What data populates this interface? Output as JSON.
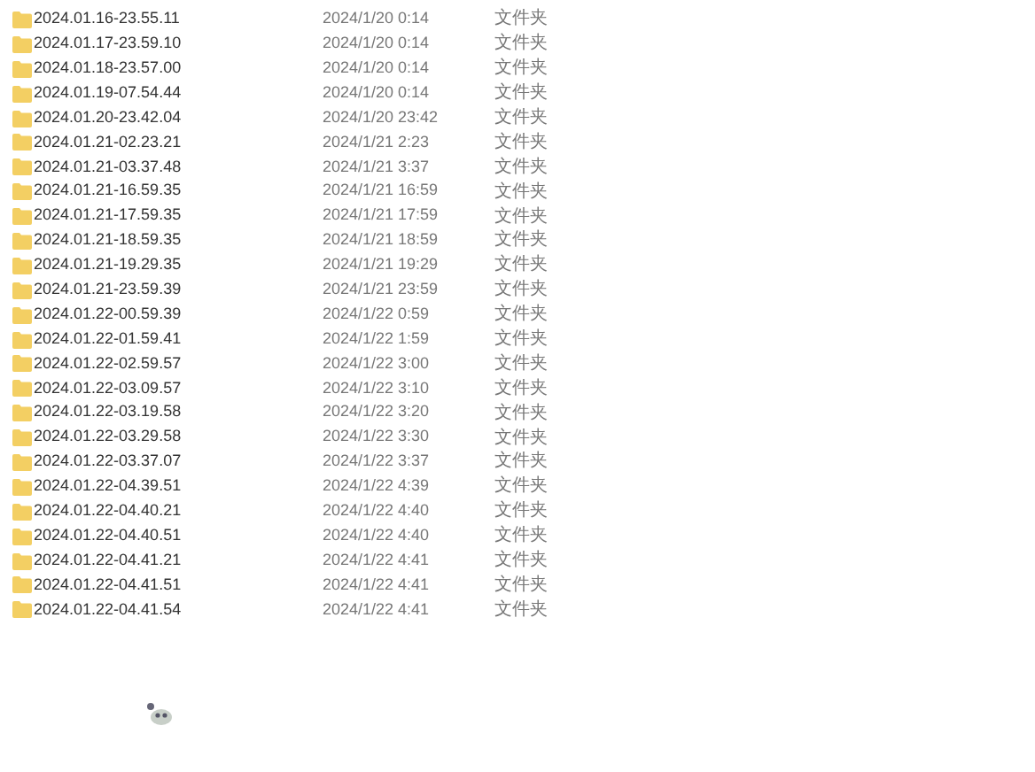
{
  "files": [
    {
      "name": "2024.01.16-23.55.11",
      "modified": "2024/1/20 0:14",
      "type": "文件夹"
    },
    {
      "name": "2024.01.17-23.59.10",
      "modified": "2024/1/20 0:14",
      "type": "文件夹"
    },
    {
      "name": "2024.01.18-23.57.00",
      "modified": "2024/1/20 0:14",
      "type": "文件夹"
    },
    {
      "name": "2024.01.19-07.54.44",
      "modified": "2024/1/20 0:14",
      "type": "文件夹"
    },
    {
      "name": "2024.01.20-23.42.04",
      "modified": "2024/1/20 23:42",
      "type": "文件夹"
    },
    {
      "name": "2024.01.21-02.23.21",
      "modified": "2024/1/21 2:23",
      "type": "文件夹"
    },
    {
      "name": "2024.01.21-03.37.48",
      "modified": "2024/1/21 3:37",
      "type": "文件夹"
    },
    {
      "name": "2024.01.21-16.59.35",
      "modified": "2024/1/21 16:59",
      "type": "文件夹"
    },
    {
      "name": "2024.01.21-17.59.35",
      "modified": "2024/1/21 17:59",
      "type": "文件夹"
    },
    {
      "name": "2024.01.21-18.59.35",
      "modified": "2024/1/21 18:59",
      "type": "文件夹"
    },
    {
      "name": "2024.01.21-19.29.35",
      "modified": "2024/1/21 19:29",
      "type": "文件夹"
    },
    {
      "name": "2024.01.21-23.59.39",
      "modified": "2024/1/21 23:59",
      "type": "文件夹"
    },
    {
      "name": "2024.01.22-00.59.39",
      "modified": "2024/1/22 0:59",
      "type": "文件夹"
    },
    {
      "name": "2024.01.22-01.59.41",
      "modified": "2024/1/22 1:59",
      "type": "文件夹"
    },
    {
      "name": "2024.01.22-02.59.57",
      "modified": "2024/1/22 3:00",
      "type": "文件夹"
    },
    {
      "name": "2024.01.22-03.09.57",
      "modified": "2024/1/22 3:10",
      "type": "文件夹"
    },
    {
      "name": "2024.01.22-03.19.58",
      "modified": "2024/1/22 3:20",
      "type": "文件夹"
    },
    {
      "name": "2024.01.22-03.29.58",
      "modified": "2024/1/22 3:30",
      "type": "文件夹"
    },
    {
      "name": "2024.01.22-03.37.07",
      "modified": "2024/1/22 3:37",
      "type": "文件夹"
    },
    {
      "name": "2024.01.22-04.39.51",
      "modified": "2024/1/22 4:39",
      "type": "文件夹"
    },
    {
      "name": "2024.01.22-04.40.21",
      "modified": "2024/1/22 4:40",
      "type": "文件夹"
    },
    {
      "name": "2024.01.22-04.40.51",
      "modified": "2024/1/22 4:40",
      "type": "文件夹"
    },
    {
      "name": "2024.01.22-04.41.21",
      "modified": "2024/1/22 4:41",
      "type": "文件夹"
    },
    {
      "name": "2024.01.22-04.41.51",
      "modified": "2024/1/22 4:41",
      "type": "文件夹"
    },
    {
      "name": "2024.01.22-04.41.54",
      "modified": "2024/1/22 4:41",
      "type": "文件夹"
    }
  ]
}
